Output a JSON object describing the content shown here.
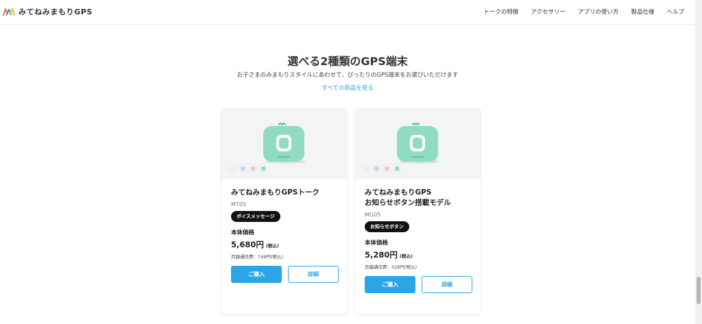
{
  "brand": {
    "name": "みてねみまもりGPS"
  },
  "nav": [
    {
      "label": "トークの特徴"
    },
    {
      "label": "アクセサリー"
    },
    {
      "label": "アプリの使い方"
    },
    {
      "label": "製品仕様"
    },
    {
      "label": "ヘルプ"
    }
  ],
  "section": {
    "title": "選べる2種類のGPS端末",
    "subtitle": "お子さまのみまもりスタイルにあわせて、ぴったりのGPS端末をお選びいただけます",
    "all_products_link": "すべての商品を見る"
  },
  "colors": {
    "accent": "#2aa5e6",
    "device": "#8fdcc3",
    "swatches": [
      "#eeeeee",
      "#b9d7f2",
      "#f2c4cc",
      "#8fdcc3"
    ]
  },
  "products": [
    {
      "name_lines": [
        "みてねみまもりGPSトーク"
      ],
      "model": "MT05",
      "badge": "ボイスメッセージ",
      "price_label": "本体価格",
      "price": "5,680円",
      "tax_note": "(税込)",
      "monthly": "月額通信費：748円(税込)",
      "buy_label": "ご購入",
      "detail_label": "詳細"
    },
    {
      "name_lines": [
        "みてねみまもりGPS",
        "お知らせボタン搭載モデル"
      ],
      "model": "MG05",
      "badge": "お知らせボタン",
      "price_label": "本体価格",
      "price": "5,280円",
      "tax_note": "(税込)",
      "monthly": "月額通信費：528円(税込)",
      "buy_label": "ご購入",
      "detail_label": "詳細"
    }
  ]
}
